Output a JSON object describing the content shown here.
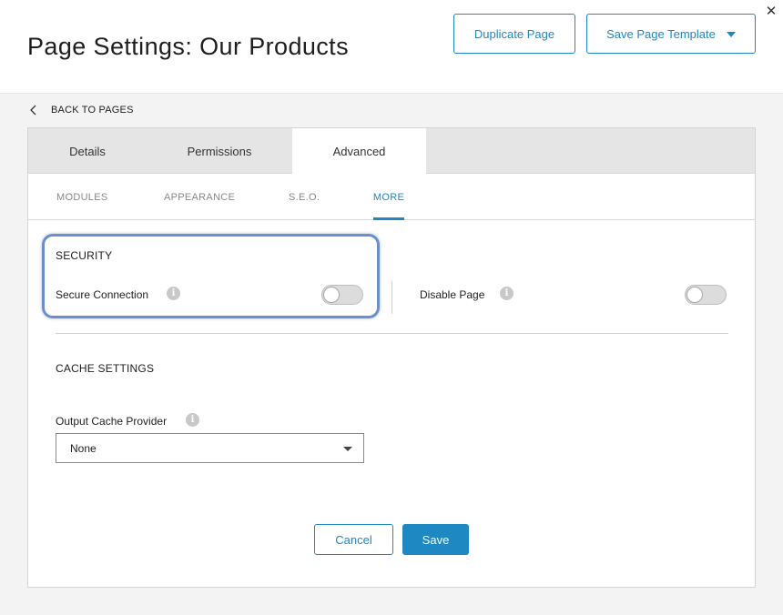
{
  "header": {
    "title": "Page Settings: Our Products",
    "duplicate_label": "Duplicate Page",
    "template_label": "Save Page Template",
    "close_symbol": "✕"
  },
  "back_link": {
    "label": "BACK TO PAGES"
  },
  "tabs": [
    {
      "label": "Details"
    },
    {
      "label": "Permissions"
    },
    {
      "label": "Advanced",
      "active": true
    }
  ],
  "subtabs": [
    {
      "label": "MODULES"
    },
    {
      "label": "APPEARANCE"
    },
    {
      "label": "S.E.O."
    },
    {
      "label": "MORE",
      "active": true
    }
  ],
  "security": {
    "title": "SECURITY",
    "secure_connection": {
      "label": "Secure Connection",
      "enabled": false
    },
    "disable_page": {
      "label": "Disable Page",
      "enabled": false
    }
  },
  "cache": {
    "title": "CACHE SETTINGS",
    "provider_label": "Output Cache Provider",
    "provider_value": "None"
  },
  "footer": {
    "cancel_label": "Cancel",
    "save_label": "Save"
  },
  "info_symbol": "i",
  "icons": {
    "close": "close-icon",
    "back": "chevron-left-icon",
    "info": "info-icon",
    "dropdown": "caret-down-icon"
  },
  "colors": {
    "accent": "#1e88c3",
    "highlight": "#6b8fc9",
    "tab_bar": "#e5e5e5"
  }
}
